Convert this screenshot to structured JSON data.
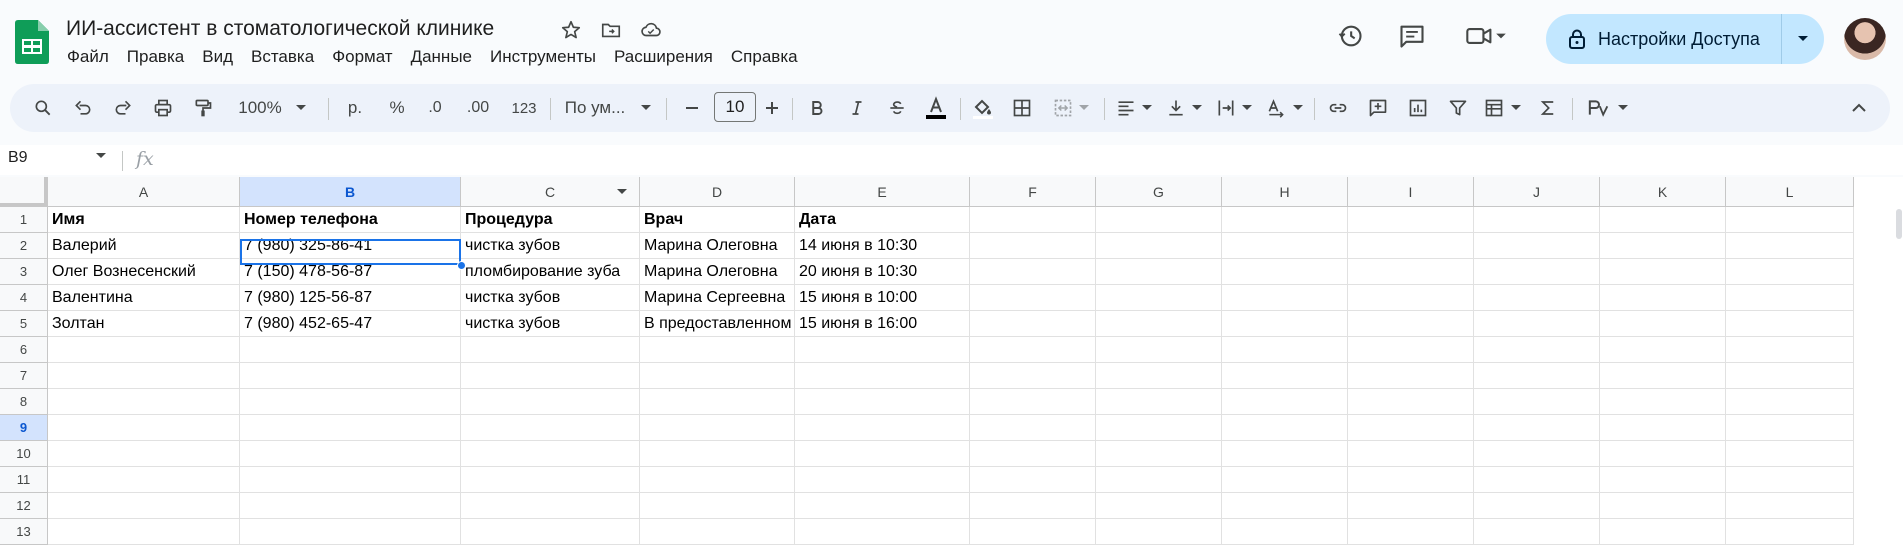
{
  "app": {
    "title": "ИИ-ассистент в стоматологической клинике",
    "accent": "#0b57d0",
    "brand_green": "#0f9d58"
  },
  "menu": [
    "Файл",
    "Правка",
    "Вид",
    "Вставка",
    "Формат",
    "Данные",
    "Инструменты",
    "Расширения",
    "Справка"
  ],
  "title_icons": [
    "star-icon",
    "move-to-folder-icon",
    "cloud-saved-icon"
  ],
  "header_actions": {
    "icons": [
      "version-history-icon",
      "comments-icon",
      "meet-icon"
    ],
    "share_label": "Настройки Доступа"
  },
  "toolbar": {
    "zoom": "100%",
    "currency": "р.",
    "percent": "%",
    "dec_decrease": ".0",
    "dec_increase": ".00",
    "number_format": "123",
    "font": "По ум...",
    "font_size": "10"
  },
  "formula_bar": {
    "name_box": "B9",
    "fx": "fx"
  },
  "sheet": {
    "columns": [
      "A",
      "B",
      "C",
      "D",
      "E",
      "F",
      "G",
      "H",
      "I",
      "J",
      "K",
      "L"
    ],
    "selected_column": "B",
    "row_numbers": [
      "1",
      "2",
      "3",
      "4",
      "5",
      "6",
      "7",
      "8",
      "9",
      "10",
      "11",
      "12",
      "13"
    ],
    "selected_row": "9",
    "selected_cell": "B9",
    "headers": [
      "Имя",
      "Номер телефона",
      "Процедура",
      "Врач",
      "Дата"
    ],
    "rows": [
      [
        "Валерий",
        "7 (980) 325-86-41",
        "чистка зубов",
        "Марина Олеговна",
        "14 июня в 10:30"
      ],
      [
        "Олег Вознесенский",
        "7 (150) 478-56-87",
        "пломбирование зуба",
        "Марина Олеговна",
        "20 июня в 10:30"
      ],
      [
        "Валентина",
        "7 (980) 125-56-87",
        "чистка зубов",
        "Марина Сергеевна",
        "15 июня в 10:00"
      ],
      [
        "Золтан",
        "7 (980) 452-65-47",
        "чистка зубов",
        "В предоставленном",
        "15 июня в 16:00"
      ]
    ]
  }
}
